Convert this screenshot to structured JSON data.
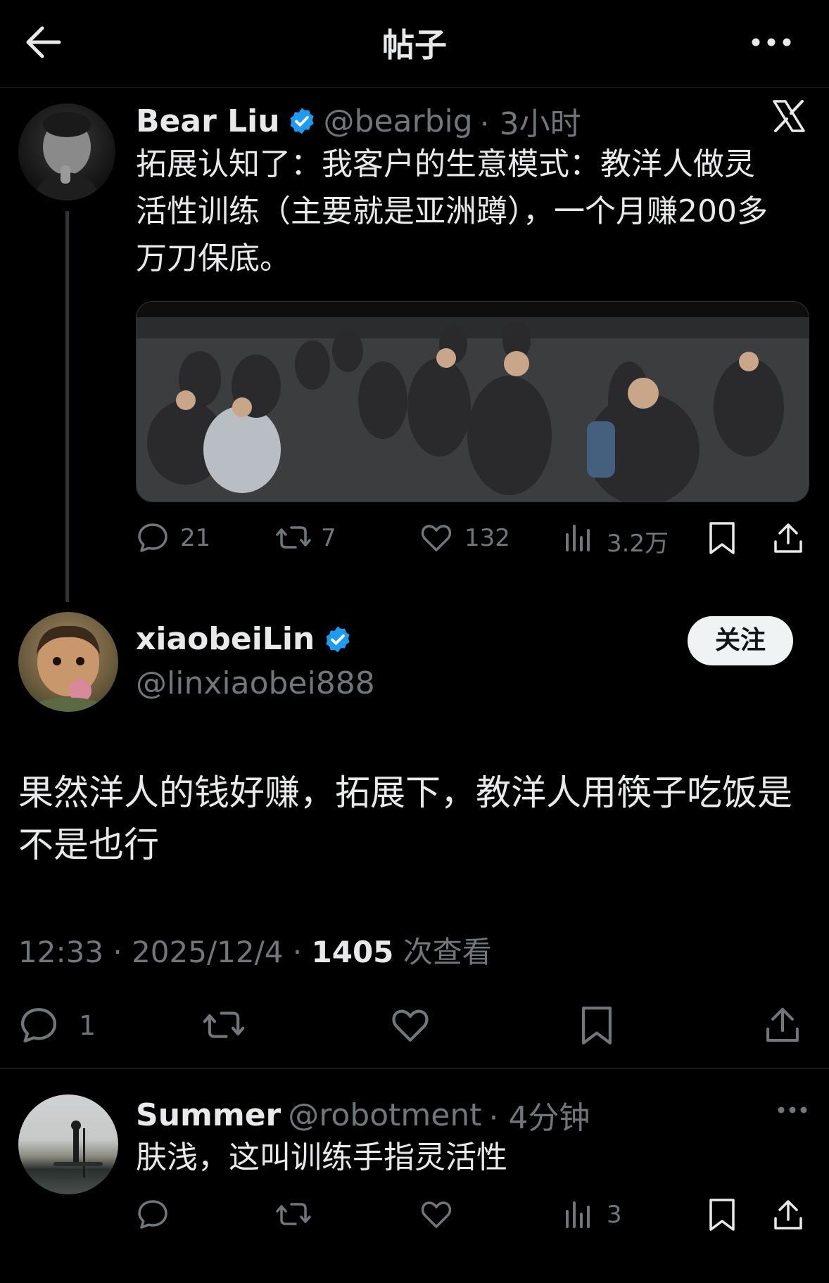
{
  "topbar": {
    "title": "帖子"
  },
  "quoted_post": {
    "author_name": "Bear Liu",
    "handle": "@bearbig",
    "time": "· 3小时",
    "text": "拓展认知了：我客户的生意模式：教洋人做灵活性训练（主要就是亚洲蹲），一个月赚200多万刀保底。",
    "stats": {
      "replies": "21",
      "reposts": "7",
      "likes": "132",
      "views": "3.2万"
    }
  },
  "main_post": {
    "author_name": "xiaobeiLin",
    "handle": "@linxiaobei888",
    "follow_label": "关注",
    "text": "果然洋人的钱好赚，拓展下，教洋人用筷子吃饭是不是也行",
    "timestamp": "12:33 · 2025/12/4 · ",
    "views": "1405",
    "views_label": " 次查看",
    "stats": {
      "replies": "1"
    }
  },
  "reply": {
    "author_name": "Summer",
    "handle": "@robotment",
    "time": "· 4分钟",
    "text": "肤浅，这叫训练手指灵活性",
    "stats": {
      "views": "3"
    }
  },
  "colors": {
    "background": "#000000",
    "text": "#e7e9ea",
    "muted": "#71767b",
    "verified": "#1d9bf0",
    "divider": "#2f3336"
  }
}
